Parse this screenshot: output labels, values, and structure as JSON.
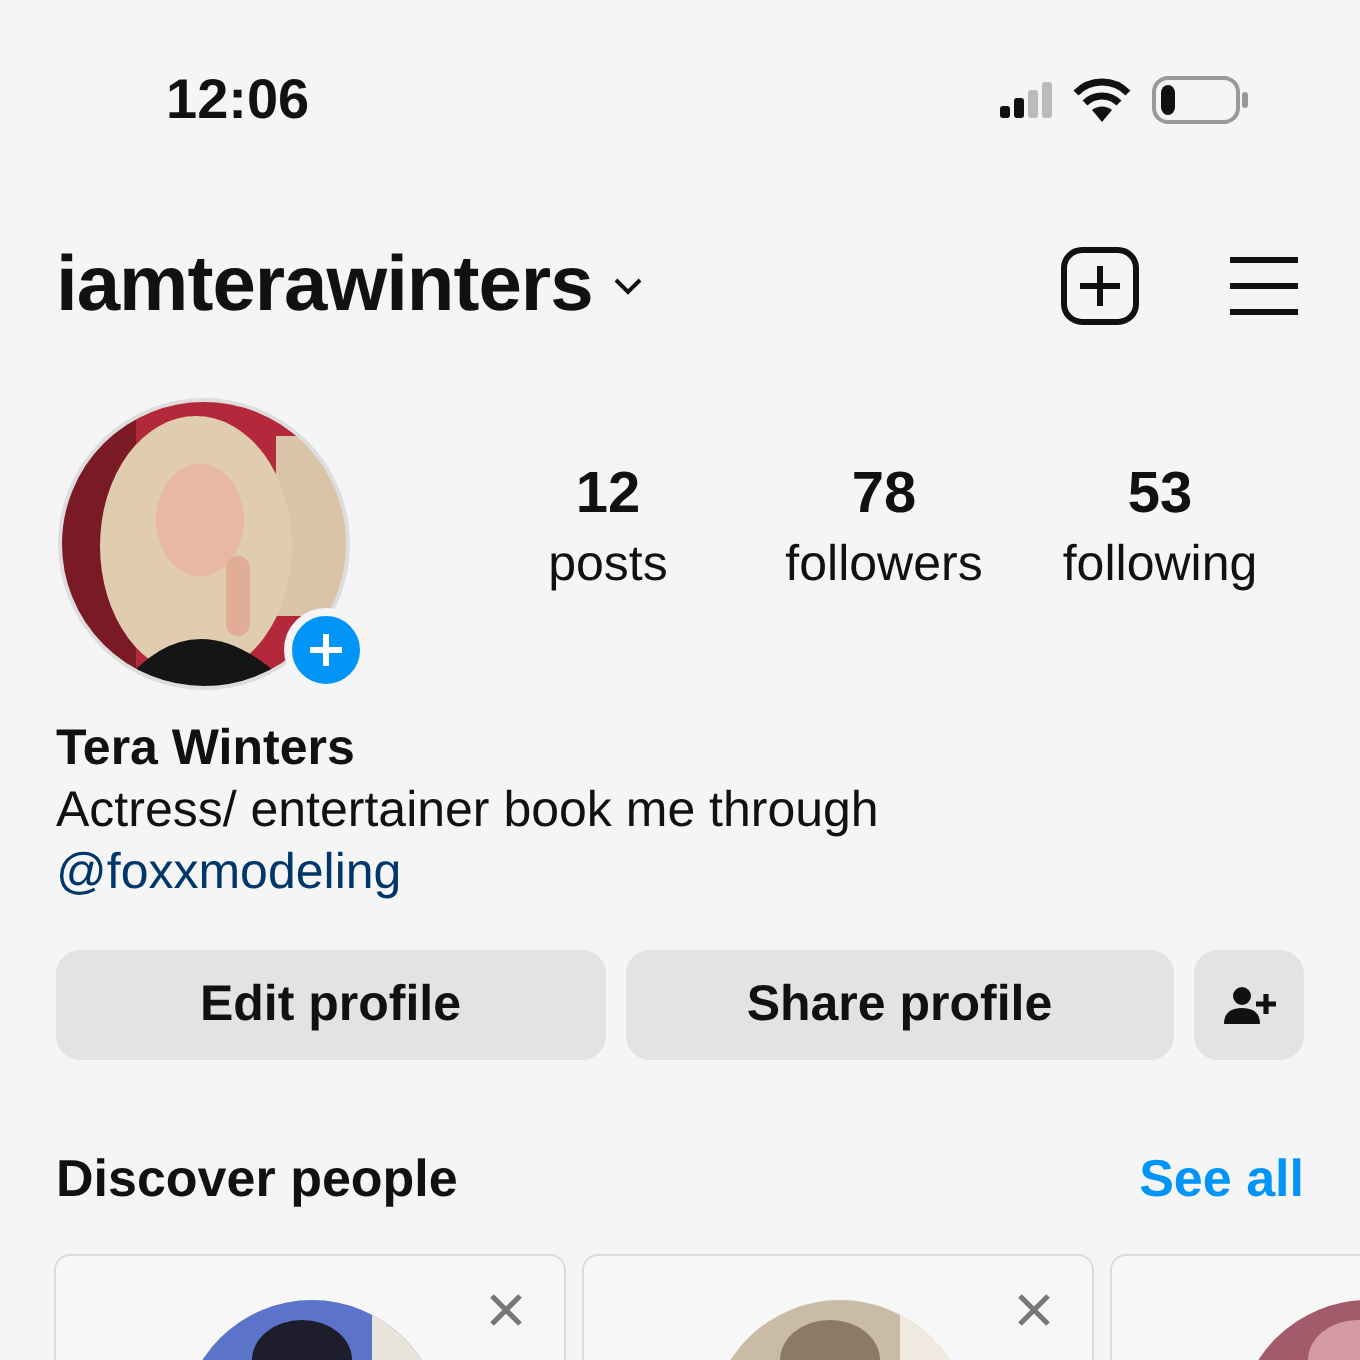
{
  "status_bar": {
    "time": "12:06"
  },
  "header": {
    "username": "iamterawinters"
  },
  "profile": {
    "stats": [
      {
        "value": "12",
        "label": "posts"
      },
      {
        "value": "78",
        "label": "followers"
      },
      {
        "value": "53",
        "label": "following"
      }
    ],
    "name": "Tera Winters",
    "bio": "Actress/ entertainer book me through",
    "link": "@foxxmodeling"
  },
  "buttons": [
    {
      "label": "Edit profile"
    },
    {
      "label": "Share profile"
    }
  ],
  "discover": {
    "title": "Discover people",
    "action": "See all",
    "suggestions": [
      {
        "kind": "full"
      },
      {
        "kind": "full"
      },
      {
        "kind": "cut_off"
      }
    ]
  }
}
